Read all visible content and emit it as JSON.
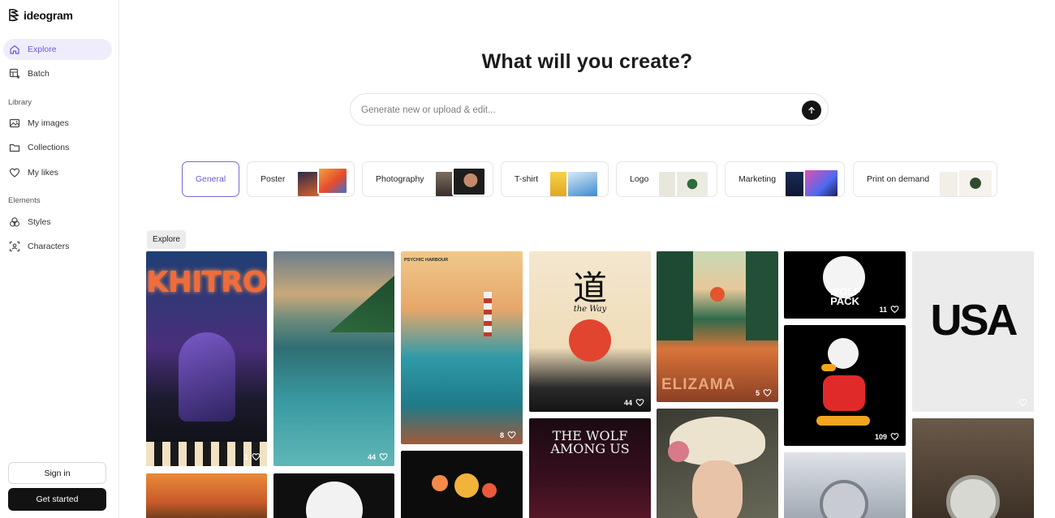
{
  "app": {
    "name": "ideogram"
  },
  "sidebar": {
    "nav": [
      {
        "label": "Explore",
        "icon": "home-icon",
        "active": true
      },
      {
        "label": "Batch",
        "icon": "batch-icon",
        "active": false
      }
    ],
    "library_heading": "Library",
    "library": [
      {
        "label": "My images",
        "icon": "images-icon"
      },
      {
        "label": "Collections",
        "icon": "folder-icon"
      },
      {
        "label": "My likes",
        "icon": "heart-icon"
      }
    ],
    "elements_heading": "Elements",
    "elements": [
      {
        "label": "Styles",
        "icon": "styles-icon"
      },
      {
        "label": "Characters",
        "icon": "characters-icon"
      }
    ],
    "sign_in": "Sign in",
    "get_started": "Get started"
  },
  "main": {
    "headline": "What will you create?",
    "prompt_placeholder": "Generate new or upload & edit...",
    "categories": [
      "General",
      "Poster",
      "Photography",
      "T-shirt",
      "Logo",
      "Marketing",
      "Print on demand"
    ],
    "explore_label": "Explore",
    "gallery": [
      {
        "title": "KHITROV",
        "likes": "1"
      },
      {
        "title": "",
        "likes": "44"
      },
      {
        "title": "PSYCHIC HARBOUR",
        "likes": "8"
      },
      {
        "title": "道",
        "subtitle": "the Way",
        "likes": "44"
      },
      {
        "title": "ELIZAMA",
        "likes": "5"
      },
      {
        "title": "WOLF PACK",
        "likes": "11"
      },
      {
        "title": "USA",
        "likes": ""
      },
      {
        "title": "",
        "likes": "109"
      },
      {
        "title": "THE WOLF AMONG US",
        "likes": ""
      }
    ]
  },
  "colors": {
    "accent": "#6e58d8",
    "accent_bg": "#efedfb",
    "dark": "#121212"
  }
}
